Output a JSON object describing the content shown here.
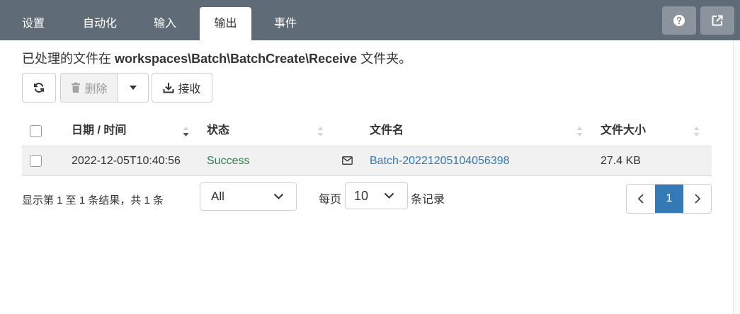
{
  "tabs": [
    {
      "label": "设置"
    },
    {
      "label": "自动化"
    },
    {
      "label": "输入"
    },
    {
      "label": "输出"
    },
    {
      "label": "事件"
    }
  ],
  "active_tab": "输出",
  "toolbar_right": {
    "help_icon": "question-circle-icon",
    "popout_icon": "external-link-icon"
  },
  "path_line": {
    "prefix": "已处理的文件在 ",
    "path": "workspaces\\Batch\\BatchCreate\\Receive",
    "suffix": " 文件夹。"
  },
  "actions": {
    "refresh_icon": "refresh-icon",
    "delete_label": "删除",
    "receive_label": "接收"
  },
  "table": {
    "columns": [
      "日期 / 时间",
      "状态",
      "文件名",
      "文件大小"
    ],
    "rows": [
      {
        "datetime": "2022-12-05T10:40:56",
        "status": "Success",
        "filename": "Batch-20221205104056398",
        "size": "27.4 KB"
      }
    ]
  },
  "footer": {
    "summary": "显示第 1 至 1 条结果，共 1 条",
    "filter_value": "All",
    "per_page_prefix": "每页",
    "per_page_value": "10",
    "per_page_suffix": "条记录",
    "current_page": "1"
  },
  "colors": {
    "topbar": "#5f6b76",
    "success": "#2e7d4f",
    "link": "#337ab7",
    "pager_active": "#337ab7"
  }
}
